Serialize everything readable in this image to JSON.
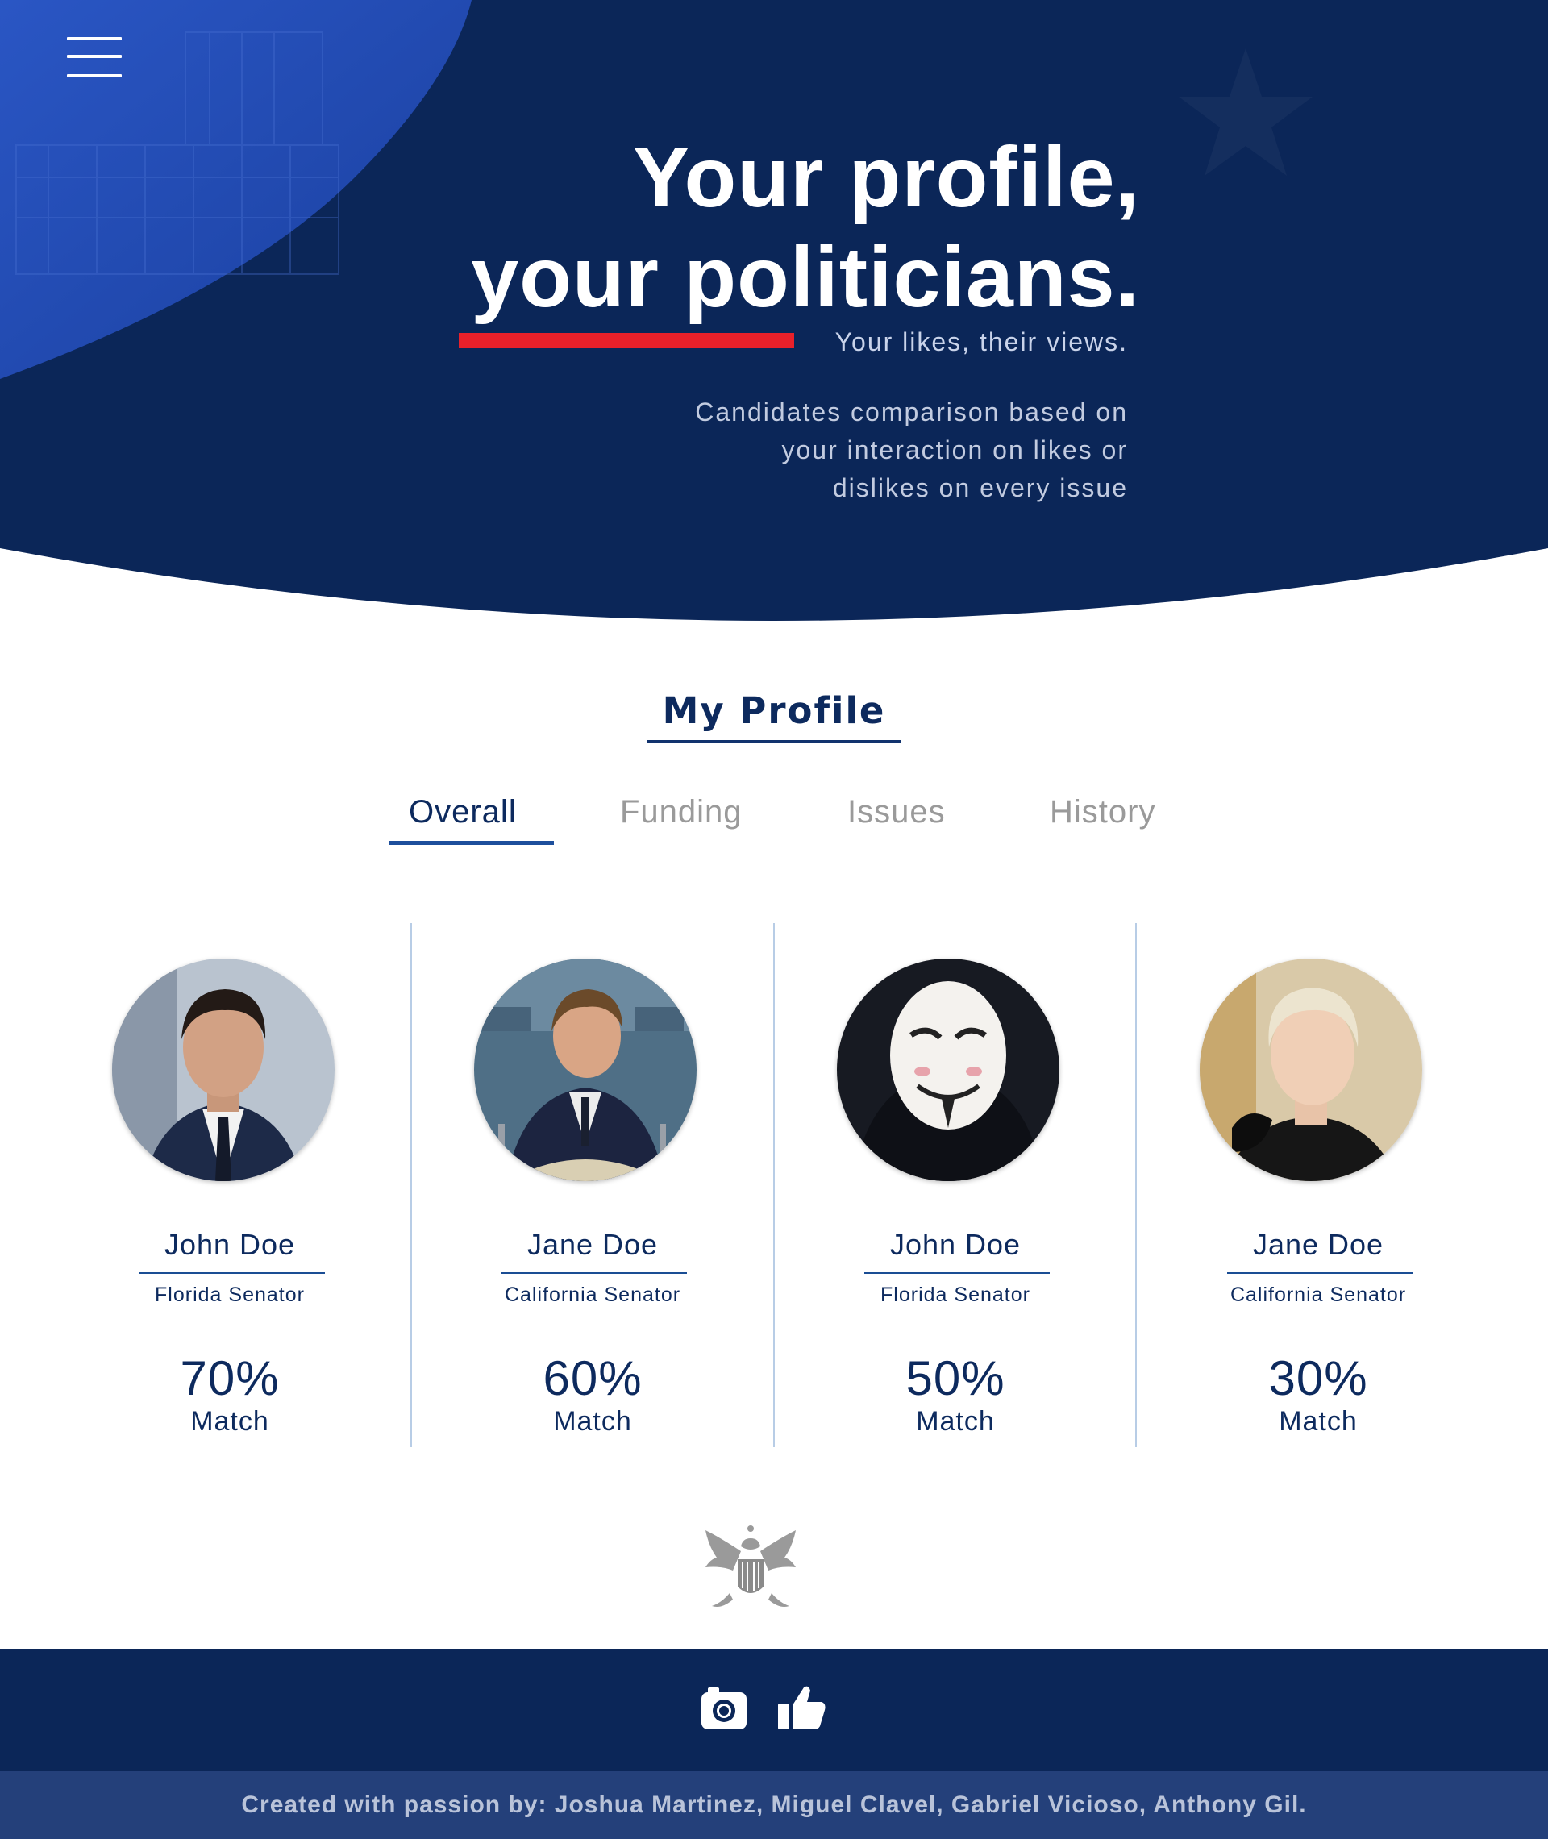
{
  "colors": {
    "navy": "#0d2a5e",
    "hero_bg": "#0b2658",
    "accent_red": "#e8202a",
    "footer_credit_bg": "#24407a"
  },
  "header": {
    "menu_icon": "hamburger-menu-icon"
  },
  "hero": {
    "title_line1": "Your profile,",
    "title_line2": "your politicians.",
    "tagline": "Your likes, their views.",
    "description_lines": [
      "Candidates comparison based on",
      "your interaction on likes or",
      "dislikes on every issue"
    ]
  },
  "profile": {
    "heading": "My Profile"
  },
  "tabs": [
    {
      "label": "Overall",
      "active": true
    },
    {
      "label": "Funding",
      "active": false
    },
    {
      "label": "Issues",
      "active": false
    },
    {
      "label": "History",
      "active": false
    }
  ],
  "candidates": [
    {
      "name": "John Doe",
      "role": "Florida Senator",
      "match_percent": "70%",
      "match_label": "Match"
    },
    {
      "name": "Jane Doe",
      "role": "California Senator",
      "match_percent": "60%",
      "match_label": "Match"
    },
    {
      "name": "John Doe",
      "role": "Florida Senator",
      "match_percent": "50%",
      "match_label": "Match"
    },
    {
      "name": "Jane Doe",
      "role": "California Senator",
      "match_percent": "30%",
      "match_label": "Match"
    }
  ],
  "footer": {
    "icons": [
      "instagram-icon",
      "thumbs-up-icon"
    ],
    "credit": "Created with passion by: Joshua Martinez, Miguel Clavel, Gabriel Vicioso, Anthony Gil."
  }
}
